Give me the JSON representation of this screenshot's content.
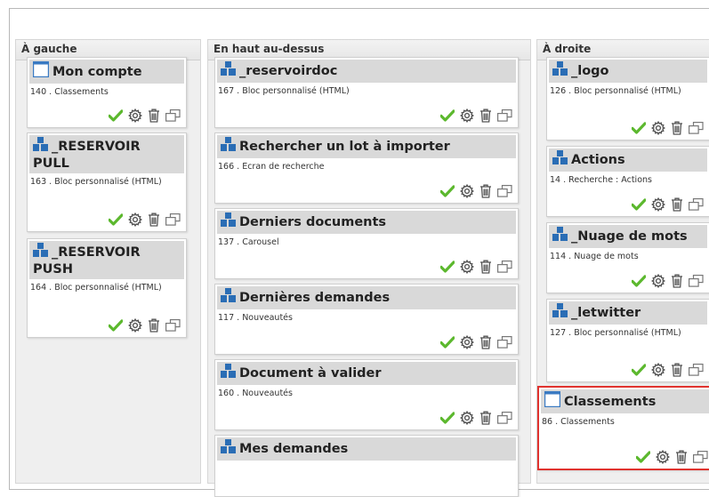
{
  "columns": [
    {
      "title": "À gauche",
      "blocks": [
        {
          "title": "Mon compte",
          "icon": "window-icon",
          "desc": "140 . Classements"
        },
        {
          "title": "_RESERVOIR PULL",
          "icon": "blocks-icon",
          "desc": "163 . Bloc personnalisé (HTML)"
        },
        {
          "title": "_RESERVOIR PUSH",
          "icon": "blocks-icon",
          "desc": "164 . Bloc personnalisé (HTML)"
        }
      ]
    },
    {
      "title": "En haut au-dessus",
      "blocks": [
        {
          "title": "_reservoirdoc",
          "icon": "blocks-icon",
          "desc": "167 . Bloc personnalisé (HTML)"
        },
        {
          "title": "Rechercher un lot à importer",
          "icon": "blocks-icon",
          "desc": "166 . Ecran de recherche"
        },
        {
          "title": "Derniers documents",
          "icon": "blocks-icon",
          "desc": "137 . Carousel"
        },
        {
          "title": "Dernières demandes",
          "icon": "blocks-icon",
          "desc": "117 . Nouveautés"
        },
        {
          "title": "Document à valider",
          "icon": "blocks-icon",
          "desc": "160 . Nouveautés"
        },
        {
          "title": "Mes demandes",
          "icon": "blocks-icon",
          "desc": ""
        }
      ]
    },
    {
      "title": "À droite",
      "blocks": [
        {
          "title": "_logo",
          "icon": "blocks-icon",
          "desc": "126 . Bloc personnalisé (HTML)"
        },
        {
          "title": "Actions",
          "icon": "blocks-icon",
          "desc": "14 . Recherche : Actions"
        },
        {
          "title": "_Nuage de mots",
          "icon": "blocks-icon",
          "desc": "114 . Nuage de mots"
        },
        {
          "title": "_letwitter",
          "icon": "blocks-icon",
          "desc": "127 . Bloc personnalisé (HTML)"
        },
        {
          "title": "Classements",
          "icon": "window-icon",
          "desc": "86 . Classements",
          "selected": true
        }
      ]
    }
  ],
  "colors": {
    "check": "#5cb82e",
    "block_icon": "#2a6db5",
    "selection": "#e0332f"
  }
}
